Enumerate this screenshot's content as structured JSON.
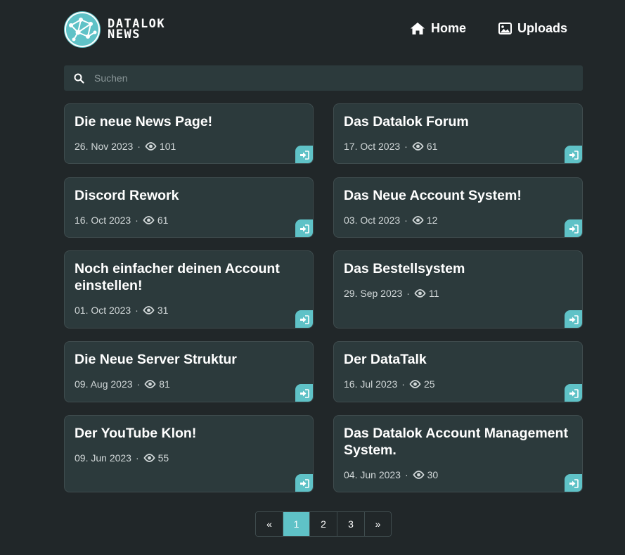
{
  "header": {
    "logo_line1": "DATALOK",
    "logo_line2": "NEWS",
    "nav": [
      {
        "label": "Home",
        "icon": "home-icon"
      },
      {
        "label": "Uploads",
        "icon": "image-icon"
      }
    ]
  },
  "search": {
    "placeholder": "Suchen",
    "value": ""
  },
  "posts": [
    {
      "title": "Die neue News Page!",
      "date": "26. Nov 2023",
      "views": "101"
    },
    {
      "title": "Das Datalok Forum",
      "date": "17. Oct 2023",
      "views": "61"
    },
    {
      "title": "Discord Rework",
      "date": "16. Oct 2023",
      "views": "61"
    },
    {
      "title": "Das Neue Account System!",
      "date": "03. Oct 2023",
      "views": "12"
    },
    {
      "title": "Noch einfacher deinen Account einstellen!",
      "date": "01. Oct 2023",
      "views": "31"
    },
    {
      "title": "Das Bestellsystem",
      "date": "29. Sep 2023",
      "views": "11"
    },
    {
      "title": "Die Neue Server Struktur",
      "date": "09. Aug 2023",
      "views": "81"
    },
    {
      "title": "Der DataTalk",
      "date": "16. Jul 2023",
      "views": "25"
    },
    {
      "title": "Der YouTube Klon!",
      "date": "09. Jun 2023",
      "views": "55"
    },
    {
      "title": "Das Datalok Account Management System.",
      "date": "04. Jun 2023",
      "views": "30"
    }
  ],
  "meta_separator": "·",
  "pagination": {
    "prev": "«",
    "pages": [
      "1",
      "2",
      "3"
    ],
    "current": "1",
    "next": "»"
  },
  "colors": {
    "background": "#212729",
    "card": "#2c3a3c",
    "accent": "#5fc2c7"
  }
}
